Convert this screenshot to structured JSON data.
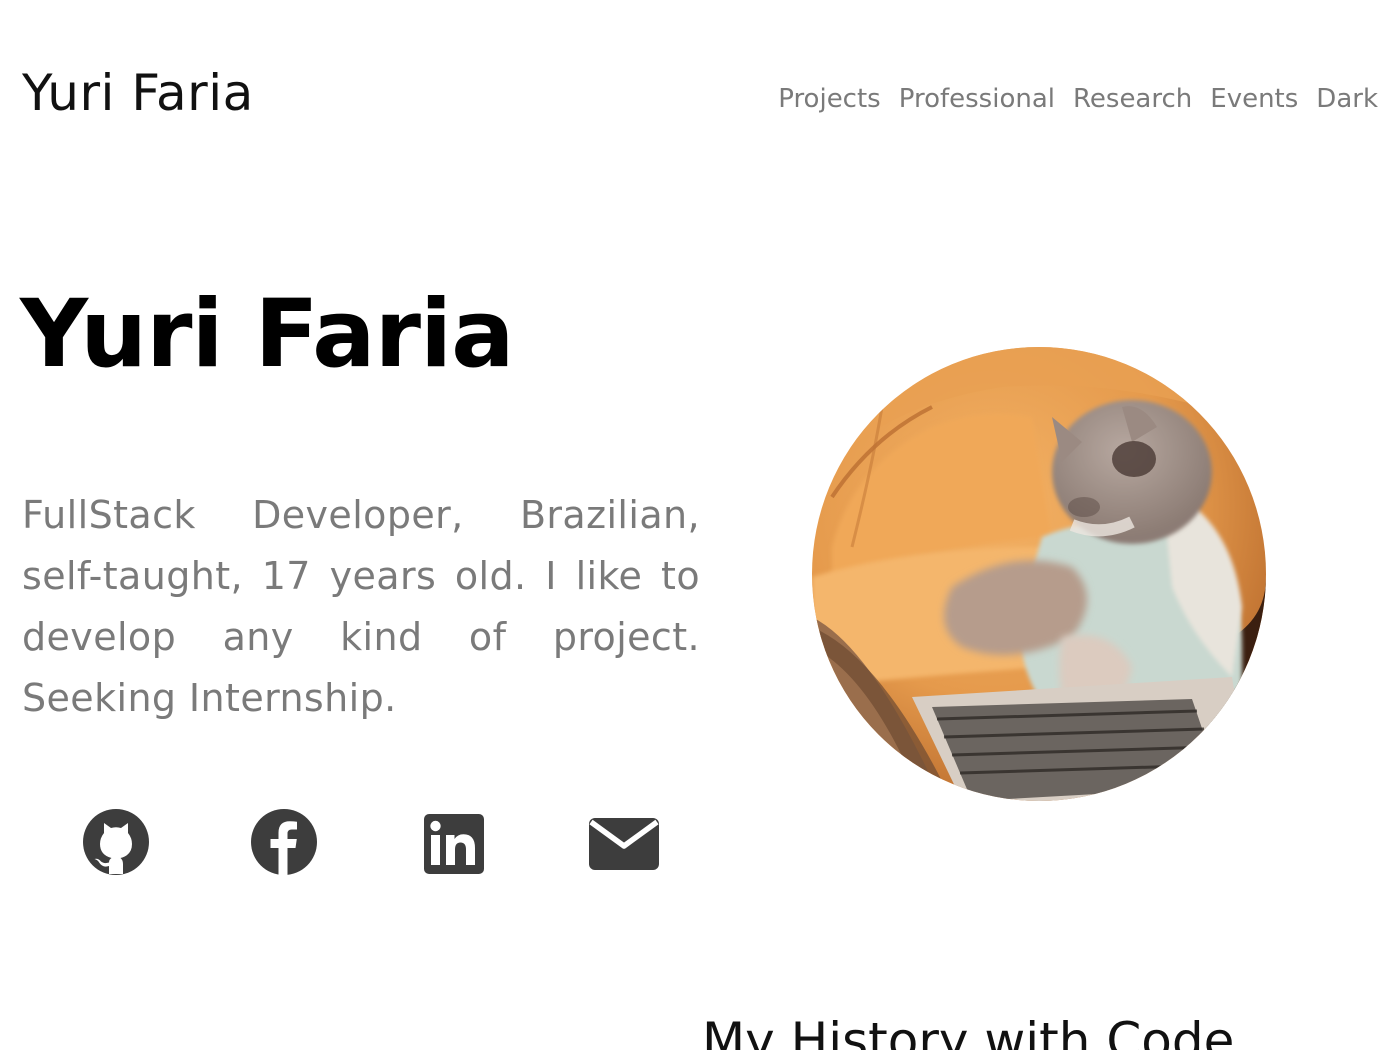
{
  "header": {
    "brand": "Yuri Faria",
    "nav": [
      {
        "label": "Projects"
      },
      {
        "label": "Professional"
      },
      {
        "label": "Research"
      },
      {
        "label": "Events"
      },
      {
        "label": "Dark"
      }
    ]
  },
  "hero": {
    "title": "Yuri Faria",
    "bio": "FullStack Developer, Brazilian, self-taught, 17 years old. I like to develop any kind of project. Seeking Internship.",
    "socials": [
      {
        "icon": "github-icon"
      },
      {
        "icon": "facebook-icon"
      },
      {
        "icon": "linkedin-icon"
      },
      {
        "icon": "mail-icon"
      }
    ],
    "avatar": {
      "icon": "cat-typing-on-laptop"
    }
  },
  "section": {
    "title": "My History with Code"
  },
  "colors": {
    "text": "#111111",
    "muted": "#7a7a7a",
    "icon": "#3d3d3d"
  }
}
